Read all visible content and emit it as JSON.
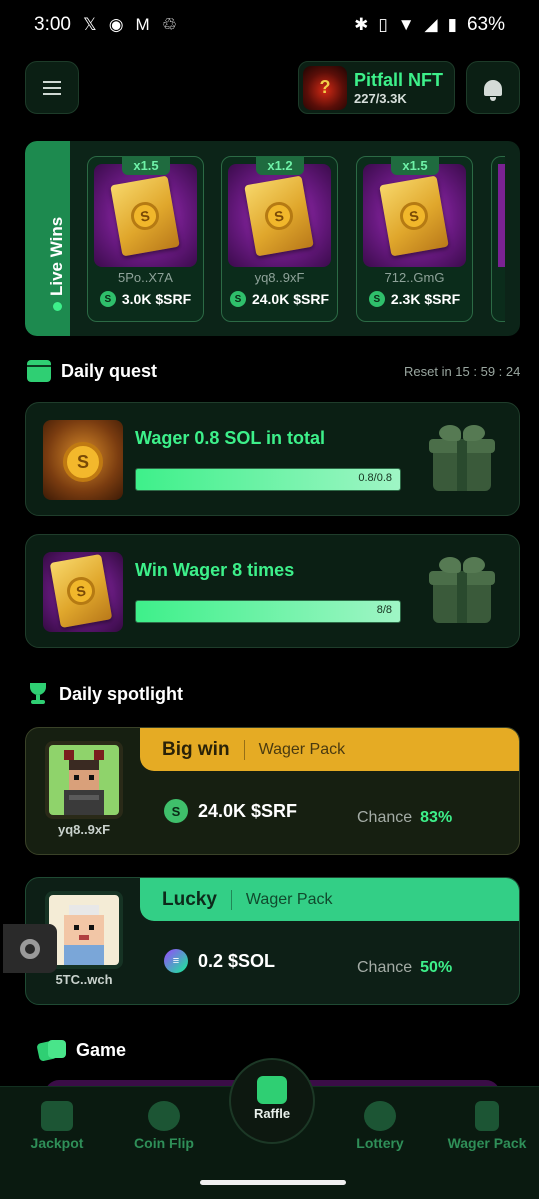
{
  "status_bar": {
    "time": "3:00",
    "battery": "63%"
  },
  "header": {
    "nft_title": "Pitfall NFT",
    "nft_count": "227/3.3K",
    "nft_icon_text": "?"
  },
  "live_wins": {
    "label": "Live Wins",
    "cards": [
      {
        "multiplier": "x1.5",
        "user": "5Po..X7A",
        "amount": "3.0K $SRF"
      },
      {
        "multiplier": "x1.2",
        "user": "yq8..9xF",
        "amount": "24.0K $SRF"
      },
      {
        "multiplier": "x1.5",
        "user": "712..GmG",
        "amount": "2.3K $SRF"
      }
    ]
  },
  "daily_quest": {
    "title": "Daily quest",
    "reset": "Reset in 15 : 59 : 24",
    "quests": [
      {
        "title": "Wager 0.8 SOL in total",
        "progress_text": "0.8/0.8",
        "progress": 1.0
      },
      {
        "title": "Win Wager 8 times",
        "progress_text": "8/8",
        "progress": 1.0
      }
    ]
  },
  "daily_spotlight": {
    "title": "Daily spotlight",
    "items": [
      {
        "type": "Big win",
        "pack": "Wager Pack",
        "user": "yq8..9xF",
        "amount": "24.0K $SRF",
        "chance_label": "Chance",
        "chance": "83%"
      },
      {
        "type": "Lucky",
        "pack": "Wager Pack",
        "user": "5TC..wch",
        "amount": "0.2 $SOL",
        "chance_label": "Chance",
        "chance": "50%"
      }
    ]
  },
  "game_section": {
    "title": "Game"
  },
  "tabbar": {
    "jackpot": "Jackpot",
    "coin_flip": "Coin Flip",
    "raffle": "Raffle",
    "lottery": "Lottery",
    "wager_pack": "Wager Pack"
  },
  "colors": {
    "accent": "#3df08a",
    "gold": "#e5ab24",
    "background": "#000000"
  }
}
